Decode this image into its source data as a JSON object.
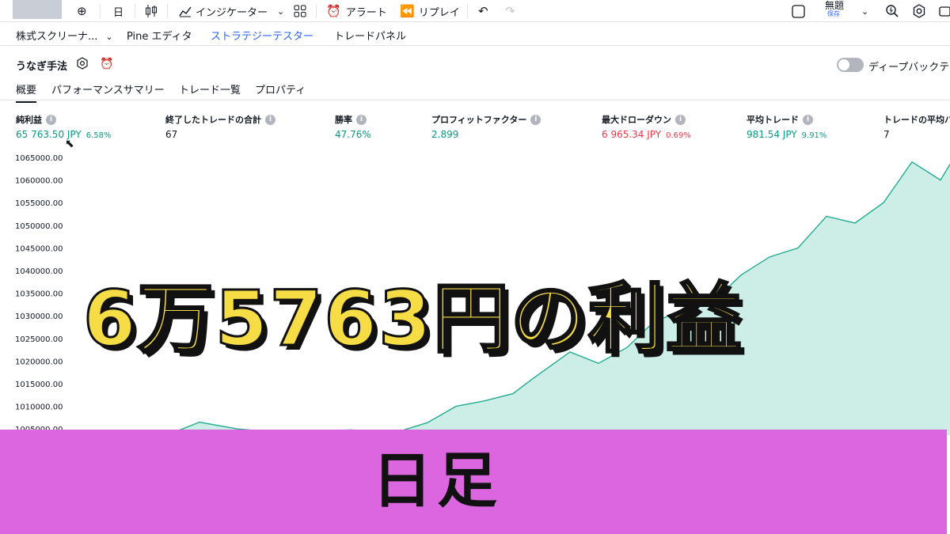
{
  "toolbar": {
    "interval": "日",
    "indicators_label": "インジケーター",
    "alert_label": "アラート",
    "replay_label": "リプレイ",
    "layout_name": "無題",
    "layout_status": "保存"
  },
  "panel_tabs": [
    {
      "label": "株式スクリーナ..."
    },
    {
      "label": "Pine エディタ"
    },
    {
      "label": "ストラテジーテスター"
    },
    {
      "label": "トレードパネル"
    }
  ],
  "strategy": {
    "name": "うなぎ手法",
    "deep_backtest_label": "ディープバックテ"
  },
  "subtabs": [
    {
      "label": "概要"
    },
    {
      "label": "パフォーマンスサマリー"
    },
    {
      "label": "トレード一覧"
    },
    {
      "label": "プロパティ"
    }
  ],
  "metrics": [
    {
      "label": "純利益",
      "value": "65 763.50 JPY",
      "pct": "6.58%"
    },
    {
      "label": "終了したトレードの合計",
      "value": "67"
    },
    {
      "label": "勝率",
      "value": "47.76%"
    },
    {
      "label": "プロフィットファクター",
      "value": "2.899"
    },
    {
      "label": "最大ドローダウン",
      "value": "6 965.34 JPY",
      "pct": "0.69%"
    },
    {
      "label": "平均トレード",
      "value": "981.54 JPY",
      "pct": "9.91%"
    },
    {
      "label": "トレードの平均バ",
      "value": "7"
    }
  ],
  "chart_data": {
    "type": "area",
    "title": "",
    "xlabel": "",
    "ylabel": "",
    "y_ticks": [
      "1065000.00",
      "1060000.00",
      "1055000.00",
      "1050000.00",
      "1045000.00",
      "1040000.00",
      "1035000.00",
      "1030000.00",
      "1025000.00",
      "1020000.00",
      "1015000.00",
      "1010000.00",
      "1005000.00"
    ],
    "ylim": [
      1003500,
      1065000
    ],
    "x": [
      0.15,
      0.17,
      0.18,
      0.21,
      0.25,
      0.29,
      0.33,
      0.37,
      0.39,
      0.41,
      0.45,
      0.48,
      0.51,
      0.54,
      0.56,
      0.6,
      0.63,
      0.66,
      0.69,
      0.72,
      0.75,
      0.78,
      0.81,
      0.84,
      0.87,
      0.9,
      0.93,
      0.96,
      0.99,
      1.0
    ],
    "values": [
      1004000,
      1004500,
      1004000,
      1006500,
      1005000,
      1004300,
      1004500,
      1004800,
      1004200,
      1003800,
      1006400,
      1010000,
      1011200,
      1012800,
      1016000,
      1022000,
      1019500,
      1023000,
      1029000,
      1031000,
      1033000,
      1039000,
      1043000,
      1045000,
      1052000,
      1050500,
      1055000,
      1064000,
      1060000,
      1063500
    ],
    "series": [
      {
        "values": [
          1004000,
          1004500,
          1004000,
          1006500,
          1005000,
          1004300,
          1004500,
          1004800,
          1004200,
          1003800,
          1006400,
          1010000,
          1011200,
          1012800,
          1016000,
          1022000,
          1019500,
          1023000,
          1029000,
          1031000,
          1033000,
          1039000,
          1043000,
          1045000,
          1052000,
          1050500,
          1055000,
          1064000,
          1060000,
          1063500
        ]
      }
    ],
    "grid": false,
    "legend": "none",
    "line_color": "#22ab94",
    "fill_color": "#cdeee6"
  },
  "overlay": {
    "headline": "6万5763円の利益",
    "banner": "日足"
  },
  "colors": {
    "positive": "#089981",
    "negative": "#f23645",
    "active_tab": "#2962ff",
    "headline": "#f6dd45",
    "banner_bg": "#db66df"
  }
}
